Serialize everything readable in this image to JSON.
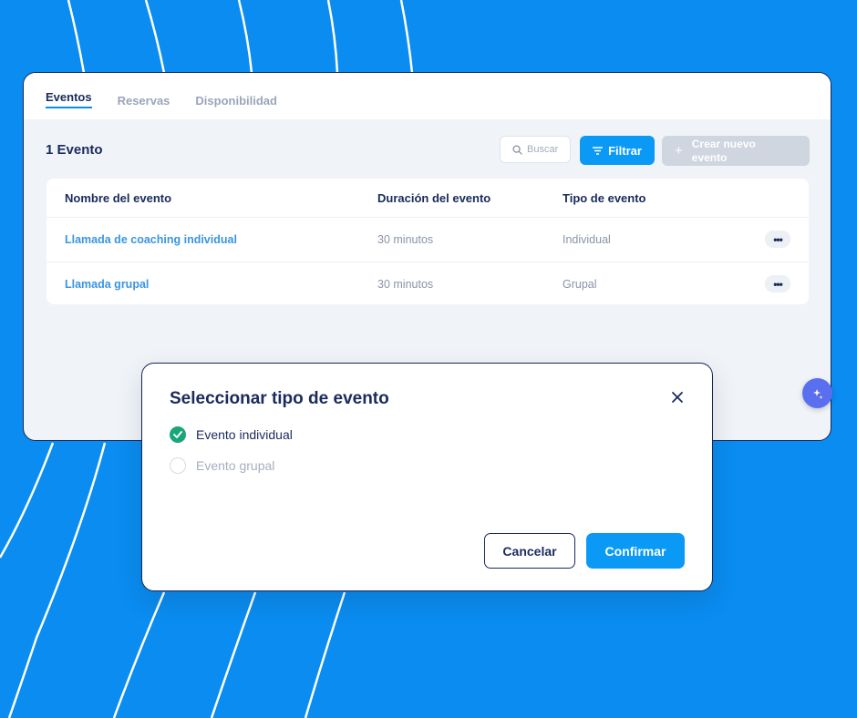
{
  "tabs": [
    {
      "label": "Eventos",
      "active": true
    },
    {
      "label": "Reservas",
      "active": false
    },
    {
      "label": "Disponibilidad",
      "active": false
    }
  ],
  "toolbar": {
    "count_label": "1 Evento",
    "search_placeholder": "Buscar",
    "filter_label": "Filtrar",
    "create_label": "Crear nuevo evento"
  },
  "table": {
    "headers": [
      "Nombre del evento",
      "Duración del evento",
      "Tipo de evento"
    ],
    "rows": [
      {
        "name": "Llamada de coaching individual",
        "duration": "30 minutos",
        "type": "Individual"
      },
      {
        "name": "Llamada grupal",
        "duration": "30 minutos",
        "type": "Grupal"
      }
    ]
  },
  "modal": {
    "title": "Seleccionar tipo de evento",
    "options": [
      {
        "label": "Evento individual",
        "selected": true
      },
      {
        "label": "Evento grupal",
        "selected": false
      }
    ],
    "cancel_label": "Cancelar",
    "confirm_label": "Confirmar"
  },
  "colors": {
    "background": "#0a8cf0",
    "primary": "#0a9af5",
    "navy": "#1a2b5c",
    "success": "#1aa57a"
  }
}
